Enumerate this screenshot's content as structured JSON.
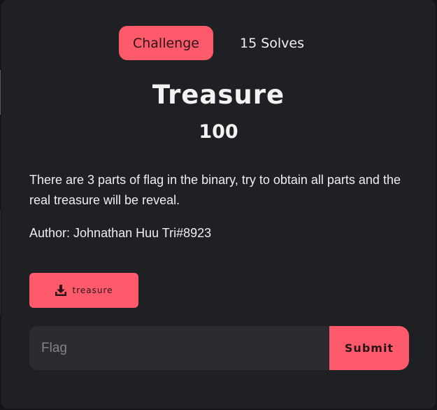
{
  "tabs": [
    {
      "label": "Challenge",
      "active": true
    },
    {
      "label": "15 Solves",
      "active": false
    }
  ],
  "challenge": {
    "name": "Treasure",
    "value": "100",
    "description": "There are 3 parts of flag in the binary, try to obtain all parts and the real treasure will be reveal.",
    "author": "Author: Johnathan Huu Tri#8923"
  },
  "file": {
    "label": "treasure",
    "icon": "download-icon"
  },
  "flag_form": {
    "placeholder": "Flag",
    "value": "",
    "submit_label": "Submit"
  },
  "colors": {
    "accent": "#fd5a6b",
    "modal_bg": "#1f2024",
    "input_bg": "#2b2c30"
  }
}
